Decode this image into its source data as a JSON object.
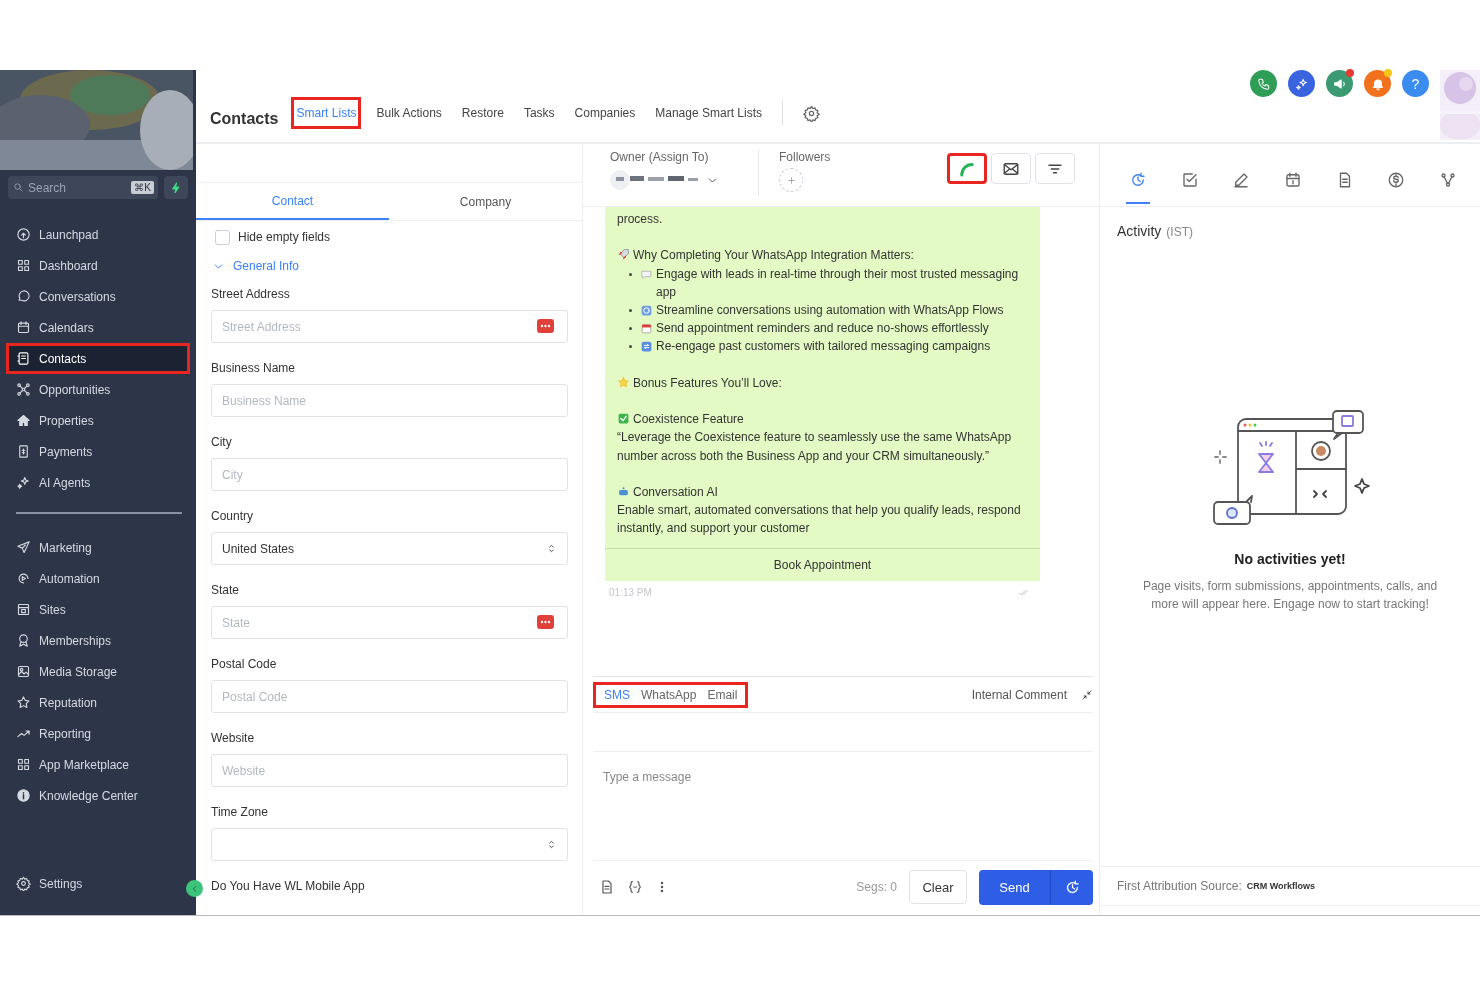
{
  "sidebar": {
    "search": {
      "placeholder": "Search",
      "shortcut": "⌘K"
    },
    "groups": [
      [
        {
          "label": "Launchpad",
          "selected": false,
          "highlighted": false
        },
        {
          "label": "Dashboard",
          "selected": false,
          "highlighted": false
        },
        {
          "label": "Conversations",
          "selected": false,
          "highlighted": false
        },
        {
          "label": "Calendars",
          "selected": false,
          "highlighted": false
        },
        {
          "label": "Contacts",
          "selected": true,
          "highlighted": true
        },
        {
          "label": "Opportunities",
          "selected": false,
          "highlighted": false
        },
        {
          "label": "Properties",
          "selected": false,
          "highlighted": false
        },
        {
          "label": "Payments",
          "selected": false,
          "highlighted": false
        },
        {
          "label": "AI Agents",
          "selected": false,
          "highlighted": false
        }
      ],
      [
        {
          "label": "Marketing",
          "selected": false,
          "highlighted": false
        },
        {
          "label": "Automation",
          "selected": false,
          "highlighted": false
        },
        {
          "label": "Sites",
          "selected": false,
          "highlighted": false
        },
        {
          "label": "Memberships",
          "selected": false,
          "highlighted": false
        },
        {
          "label": "Media Storage",
          "selected": false,
          "highlighted": false
        },
        {
          "label": "Reputation",
          "selected": false,
          "highlighted": false
        },
        {
          "label": "Reporting",
          "selected": false,
          "highlighted": false
        },
        {
          "label": "App Marketplace",
          "selected": false,
          "highlighted": false
        },
        {
          "label": "Knowledge Center",
          "selected": false,
          "highlighted": false
        }
      ]
    ],
    "settings": {
      "label": "Settings"
    }
  },
  "header": {
    "title": "Contacts",
    "tabs": [
      {
        "label": "Smart Lists",
        "selected": true,
        "highlighted": true
      },
      {
        "label": "Bulk Actions",
        "selected": false,
        "highlighted": false
      },
      {
        "label": "Restore",
        "selected": false,
        "highlighted": false
      },
      {
        "label": "Tasks",
        "selected": false,
        "highlighted": false
      },
      {
        "label": "Companies",
        "selected": false,
        "highlighted": false
      },
      {
        "label": "Manage Smart Lists",
        "selected": false,
        "highlighted": false
      }
    ]
  },
  "top_actions": {
    "buttons": [
      {
        "color": "#2e9e57"
      },
      {
        "color": "#3a63e0"
      },
      {
        "color": "#3c9a72",
        "dot": {
          "color": "#e53935"
        }
      },
      {
        "color": "#f2711c",
        "dot": {
          "color": "#f5c518"
        }
      },
      {
        "color": "#3b8cf0",
        "label": "?"
      }
    ]
  },
  "left_panel": {
    "tabs": [
      {
        "label": "Contact",
        "selected": true
      },
      {
        "label": "Company",
        "selected": false
      }
    ],
    "hide_empty": {
      "label": "Hide empty fields",
      "checked": false
    },
    "section": {
      "label": "General Info",
      "expanded": true
    },
    "fields": [
      {
        "label": "Street Address",
        "kind": "input",
        "placeholder": "Street Address",
        "action_icon": true
      },
      {
        "label": "Business Name",
        "kind": "input",
        "placeholder": "Business Name",
        "action_icon": false
      },
      {
        "label": "City",
        "kind": "input",
        "placeholder": "City",
        "action_icon": false
      },
      {
        "label": "Country",
        "kind": "select",
        "value": "United States"
      },
      {
        "label": "State",
        "kind": "input",
        "placeholder": "State",
        "action_icon": true
      },
      {
        "label": "Postal Code",
        "kind": "input",
        "placeholder": "Postal Code",
        "action_icon": false
      },
      {
        "label": "Website",
        "kind": "input",
        "placeholder": "Website",
        "action_icon": false
      },
      {
        "label": "Time Zone",
        "kind": "select"
      }
    ],
    "next_label": "Do You Have WL Mobile App"
  },
  "conversation": {
    "owner": {
      "label": "Owner (Assign To)"
    },
    "followers": {
      "label": "Followers"
    },
    "actions": [
      {
        "highlighted": true
      },
      {
        "highlighted": false
      },
      {
        "highlighted": false
      }
    ],
    "message": {
      "blocks": [
        {
          "kind": "text",
          "text": "process.",
          "icon": false
        },
        {
          "kind": "heading",
          "text": "Why Completing Your WhatsApp Integration Matters:",
          "icon": true
        },
        {
          "kind": "bullet",
          "text": "Engage with leads in real-time through their most trusted messaging app",
          "icon": true
        },
        {
          "kind": "bullet",
          "text": "Streamline conversations using automation with WhatsApp Flows",
          "icon": true
        },
        {
          "kind": "bullet",
          "text": "Send appointment reminders and reduce no-shows effortlessly",
          "icon": true
        },
        {
          "kind": "bullet",
          "text": "Re-engage past customers with tailored messaging campaigns",
          "icon": true
        },
        {
          "kind": "heading",
          "text": "Bonus Features You’ll Love:",
          "icon": true
        },
        {
          "kind": "heading",
          "text": "Coexistence Feature",
          "icon": true
        },
        {
          "kind": "text",
          "text": "“Leverage the Coexistence feature to seamlessly use the same WhatsApp number across both the Business App and your CRM simultaneously.”",
          "icon": false
        },
        {
          "kind": "heading",
          "text": "Conversation AI",
          "icon": true
        },
        {
          "kind": "text",
          "text": "Enable smart, automated conversations that help you qualify leads, respond instantly, and support your customer",
          "icon": false
        }
      ],
      "button": "Book Appointment",
      "time": "01:13 PM"
    },
    "composer": {
      "channels": [
        {
          "label": "SMS",
          "selected": true
        },
        {
          "label": "WhatsApp",
          "selected": false
        },
        {
          "label": "Email",
          "selected": false
        }
      ],
      "channels_highlighted": true,
      "internal_comment": "Internal Comment",
      "placeholder": "Type a message",
      "segs": "Segs: 0",
      "clear": "Clear",
      "send": "Send"
    }
  },
  "activity": {
    "tabs": [
      {
        "selected": true
      },
      {
        "selected": false
      },
      {
        "selected": false
      },
      {
        "selected": false
      },
      {
        "selected": false
      },
      {
        "selected": false
      },
      {
        "selected": false
      }
    ],
    "title": "Activity",
    "timezone": "(IST)",
    "empty_title": "No activities yet!",
    "empty_text": "Page visits, form submissions, appointments, calls, and more will appear here. Engage now to start tracking!",
    "attribution_label": "First Attribution Source:",
    "attribution_value": "CRM Workflows"
  }
}
